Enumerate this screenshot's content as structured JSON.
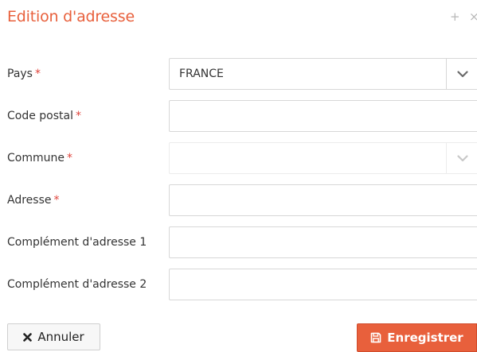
{
  "dialog": {
    "title": "Edition d'adresse",
    "actions": {
      "expand_glyph": "+",
      "close_glyph": "×"
    }
  },
  "form": {
    "required_marker": "*",
    "fields": [
      {
        "label": "Pays",
        "required": true,
        "type": "select",
        "value": "FRANCE",
        "disabled": false
      },
      {
        "label": "Code postal",
        "required": true,
        "type": "text",
        "value": ""
      },
      {
        "label": "Commune",
        "required": true,
        "type": "select",
        "value": "",
        "disabled": true
      },
      {
        "label": "Adresse",
        "required": true,
        "type": "text",
        "value": ""
      },
      {
        "label": "Complément d'adresse 1",
        "required": false,
        "type": "text",
        "value": ""
      },
      {
        "label": "Complément d'adresse 2",
        "required": false,
        "type": "text",
        "value": ""
      }
    ]
  },
  "buttons": {
    "cancel_label": "Annuler",
    "cancel_icon": "times-icon",
    "save_label": "Enregistrer",
    "save_icon": "floppy-disk-icon"
  },
  "colors": {
    "accent": "#e8603c",
    "required": "#e0443c",
    "border": "#d7d7d7"
  }
}
